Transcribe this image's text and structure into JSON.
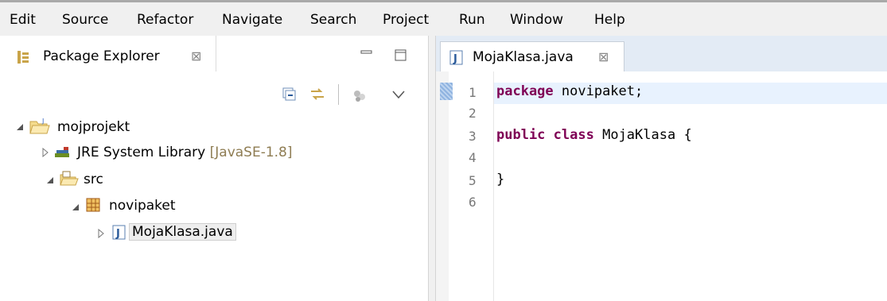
{
  "menu": [
    "Edit",
    "Source",
    "Refactor",
    "Navigate",
    "Search",
    "Project",
    "Run",
    "Window",
    "Help"
  ],
  "package_explorer": {
    "title": "Package Explorer",
    "close_glyph": "⊠",
    "tree": {
      "project": "mojprojekt",
      "jre_label": "JRE System Library",
      "jre_decoration": "[JavaSE-1.8]",
      "src": "src",
      "package": "novipaket",
      "file": "MojaKlasa.java"
    }
  },
  "editor": {
    "tab_title": "MojaKlasa.java",
    "close_glyph": "⊠",
    "line_numbers": [
      "1",
      "2",
      "3",
      "4",
      "5",
      "6"
    ],
    "code": {
      "l1_kw": "package",
      "l1_rest": " novipaket;",
      "l3_kw1": "public",
      "l3_kw2": "class",
      "l3_rest": " MojaKlasa {",
      "l5": "}"
    }
  },
  "colors": {
    "keyword": "#7f0055",
    "current_line": "#e8f2fe",
    "decoration": "#8e7c52",
    "editor_tabbar": "#e3ebf5"
  }
}
